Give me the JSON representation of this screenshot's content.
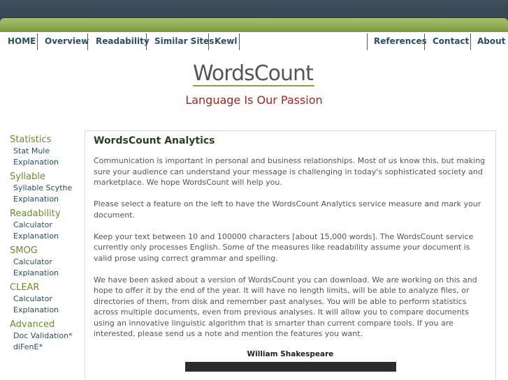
{
  "nav": {
    "left": [
      "HOME",
      "Overview",
      "Readability",
      "Similar Sites",
      "Kewl"
    ],
    "right": [
      "References",
      "Contact",
      "About"
    ]
  },
  "logo": {
    "text": "WordsCount"
  },
  "tagline": "Language Is Our Passion",
  "sidebar": {
    "groups": [
      {
        "head": "Statistics",
        "links": [
          "Stat Mule",
          "Explanation"
        ]
      },
      {
        "head": "Syllable",
        "links": [
          "Syllable Scythe",
          "Explanation"
        ]
      },
      {
        "head": "Readability",
        "links": [
          "Calculator",
          "Explanation"
        ]
      },
      {
        "head": "SMOG",
        "links": [
          "Calculator",
          "Explanation"
        ]
      },
      {
        "head": "CLEAR",
        "links": [
          "Calculator",
          "Explanation"
        ]
      },
      {
        "head": "Advanced",
        "links": [
          "Doc Validation*",
          "diFenE*"
        ]
      }
    ]
  },
  "main": {
    "title": "WordsCount Analytics",
    "paragraphs": [
      "Communication is important in personal and business relationships. Most of us know this, but making sure your audience can understand your message is challenging in today's sophisticated society and marketplace. We hope WordsCount will help you.",
      "Please select a feature on the left to have the WordsCount Analytics service measure and mark your document.",
      "Keep your text between 10 and 100000 characters [about 15,000 words]. The WordsCount service currently only processes English. Some of the measures like readability assume your document is valid prose using correct grammar and spelling.",
      "We have been asked about a version of WordsCount you can download. We are working on this and hope to offer it by the end of the year. It will have no length limits, will be able to analyze files, or directories of them, from disk and remember past analyses. You will be able to perform statistics across multiple documents, even from previous analyses. It will allow you to compare documents using an innovative linguistic algorithm that is smarter than current compare tools. If you are interested, please send us a note and mention the features you want."
    ],
    "quote_title": "William Shakespeare"
  }
}
